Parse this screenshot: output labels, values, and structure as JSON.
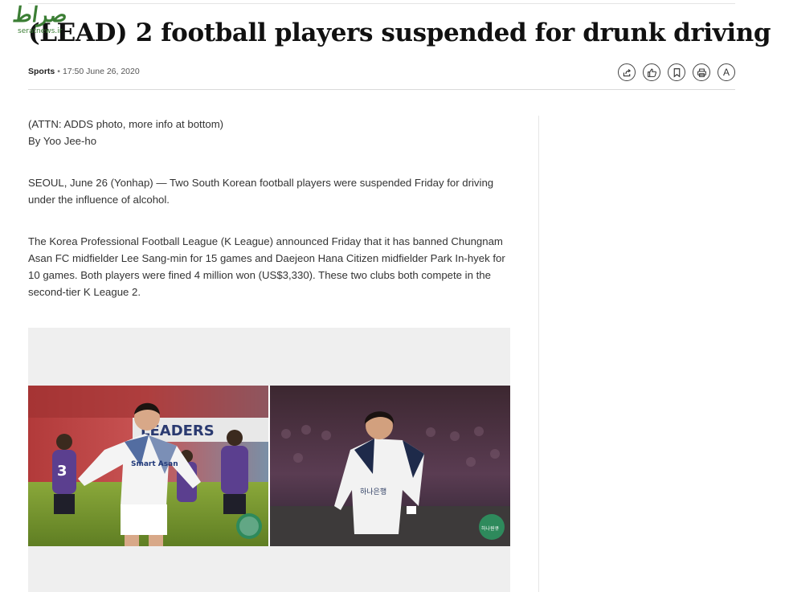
{
  "watermark": {
    "logo_text": "صراط",
    "site_text": "seratnews.ir"
  },
  "article": {
    "headline": "(LEAD) 2 football players suspended for drunk driving",
    "section": "Sports",
    "separator": "•",
    "timestamp": "17:50 June 26, 2020",
    "paragraphs": {
      "attn": "(ATTN: ADDS photo, more info at bottom)",
      "byline": "By Yoo Jee-ho",
      "lead": "SEOUL, June 26 (Yonhap) — Two South Korean football players were suspended Friday for driving under the influence of alcohol.",
      "body": "The Korea Professional Football League (K League) announced Friday that it has banned Chungnam Asan FC midfielder Lee Sang-min for 15 games and Daejeon Hana Citizen midfielder Park In-hyek for 10 games. Both players were fined 4 million won (US$3,330). These two clubs both compete in the second-tier K League 2."
    }
  },
  "toolbar": {
    "icons": [
      "share-icon",
      "like-icon",
      "bookmark-icon",
      "print-icon",
      "font-size-icon"
    ],
    "font_label": "A"
  },
  "photo": {
    "left_jersey_text": "Smart Asan",
    "left_player_number": "3",
    "left_banner_text": "LEADERS",
    "right_jersey_text": "하나은행",
    "badge_text": "하나원큐"
  },
  "colors": {
    "headline": "#111111",
    "text": "#333333",
    "divider": "#d9d9d9",
    "photo_bg": "#efefef",
    "watermark_green": "#3b7e34"
  }
}
